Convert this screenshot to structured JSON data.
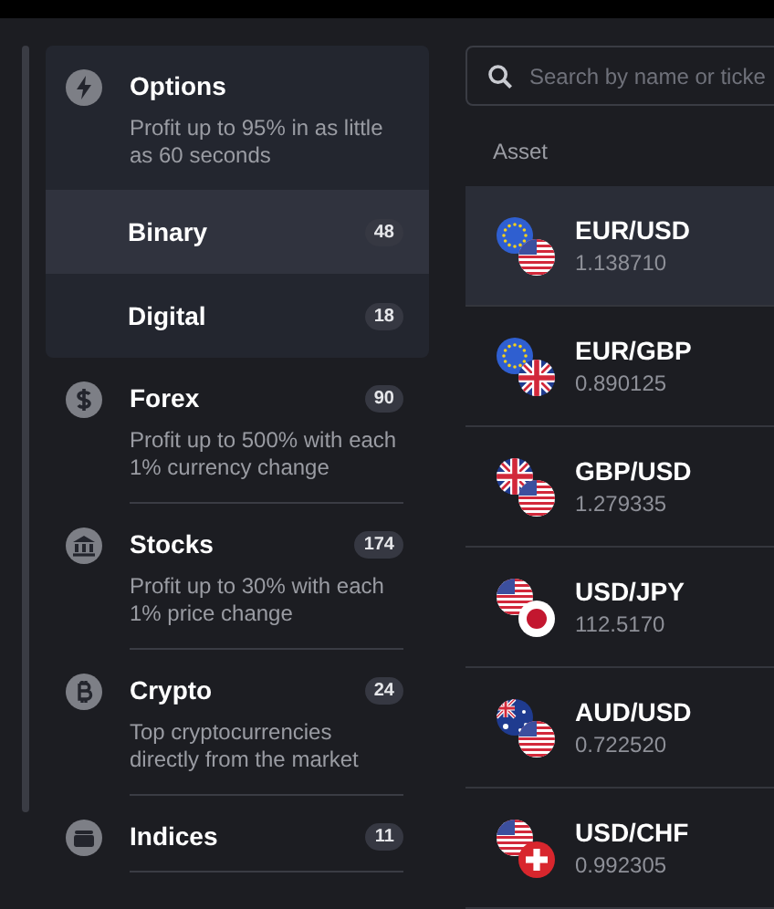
{
  "categories": [
    {
      "kind": "options",
      "title": "Options",
      "description": "Profit up to 95% in as little as 60 seconds",
      "expanded": true,
      "children": [
        {
          "label": "Binary",
          "count": "48",
          "selected": true
        },
        {
          "label": "Digital",
          "count": "18",
          "selected": false
        }
      ]
    },
    {
      "kind": "forex",
      "title": "Forex",
      "count": "90",
      "description": "Profit up to 500% with each 1% currency change",
      "expanded": false
    },
    {
      "kind": "stocks",
      "title": "Stocks",
      "count": "174",
      "description": "Profit up to 30% with each 1% price change",
      "expanded": false
    },
    {
      "kind": "crypto",
      "title": "Crypto",
      "count": "24",
      "description": "Top cryptocurrencies directly from the market",
      "expanded": false
    },
    {
      "kind": "indices",
      "title": "Indices",
      "count": "11",
      "expanded": false
    }
  ],
  "search": {
    "placeholder": "Search by name or ticke"
  },
  "asset_header": "Asset",
  "assets": [
    {
      "name": "EUR/USD",
      "price": "1.138710",
      "selected": true
    },
    {
      "name": "EUR/GBP",
      "price": "0.890125",
      "selected": false
    },
    {
      "name": "GBP/USD",
      "price": "1.279335",
      "selected": false
    },
    {
      "name": "USD/JPY",
      "price": "112.5170",
      "selected": false
    },
    {
      "name": "AUD/USD",
      "price": "0.722520",
      "selected": false
    },
    {
      "name": "USD/CHF",
      "price": "0.992305",
      "selected": false
    }
  ]
}
